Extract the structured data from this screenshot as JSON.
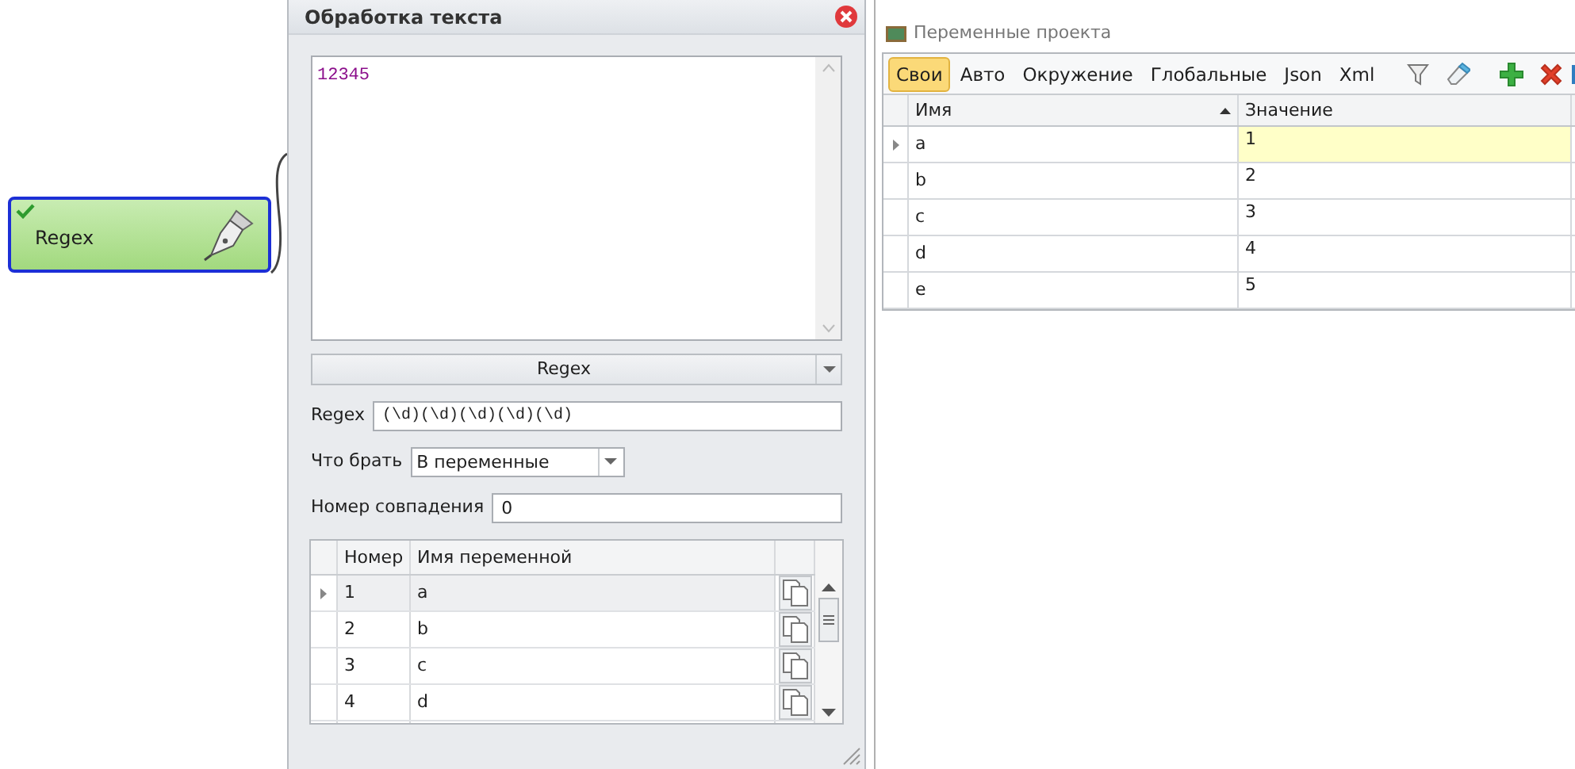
{
  "node": {
    "label": "Regex",
    "checked": true,
    "selected": true
  },
  "dialog": {
    "title": "Обработка текста",
    "text": "12345",
    "mode": "Regex",
    "regex_label": "Regex",
    "regex": "(\\d)(\\d)(\\d)(\\d)(\\d)",
    "take_label": "Что брать",
    "take": "В переменные",
    "match_label": "Номер совпадения",
    "match": "0",
    "table": {
      "columns": [
        "Номер",
        "Имя переменной"
      ],
      "rows": [
        {
          "number": "1",
          "name": "a",
          "selected": true
        },
        {
          "number": "2",
          "name": "b",
          "selected": false
        },
        {
          "number": "3",
          "name": "c",
          "selected": false
        },
        {
          "number": "4",
          "name": "d",
          "selected": false
        }
      ]
    }
  },
  "variables": {
    "title": "Переменные проекта",
    "tabs": [
      {
        "label": "Свои",
        "selected": true
      },
      {
        "label": "Авто",
        "selected": false
      },
      {
        "label": "Окружение",
        "selected": false
      },
      {
        "label": "Глобальные",
        "selected": false
      },
      {
        "label": "Json",
        "selected": false
      },
      {
        "label": "Xml",
        "selected": false
      }
    ],
    "columns": [
      "Имя",
      "Значение"
    ],
    "rows": [
      {
        "name": "a",
        "value": "1",
        "selected": true
      },
      {
        "name": "b",
        "value": "2",
        "selected": false
      },
      {
        "name": "c",
        "value": "3",
        "selected": false
      },
      {
        "name": "d",
        "value": "4",
        "selected": false
      },
      {
        "name": "e",
        "value": "5",
        "selected": false
      }
    ]
  }
}
